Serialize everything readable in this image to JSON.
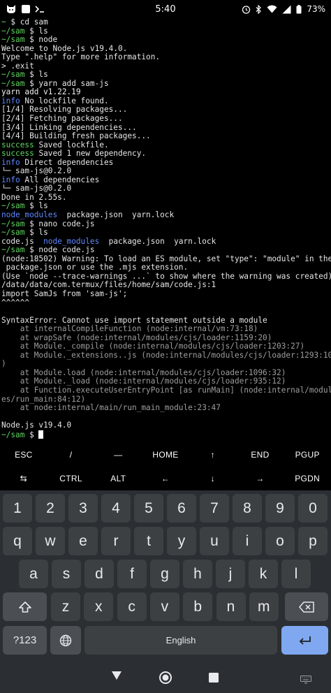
{
  "status_bar": {
    "time": "5:40",
    "battery": "73%",
    "left_icons": [
      "cat-app-icon",
      "image-notification-icon",
      "terminal-prompt-icon"
    ],
    "right_icons": [
      "alarm-icon",
      "bluetooth-icon",
      "wifi-icon",
      "signal-icon",
      "battery-icon"
    ]
  },
  "terminal": {
    "lines": [
      [
        {
          "t": "~ ",
          "c": "c-green"
        },
        {
          "t": "$ cd sam",
          "c": ""
        }
      ],
      [
        {
          "t": "~/sam ",
          "c": "c-green"
        },
        {
          "t": "$ ls",
          "c": ""
        }
      ],
      [
        {
          "t": "~/sam ",
          "c": "c-green"
        },
        {
          "t": "$ node",
          "c": ""
        }
      ],
      [
        {
          "t": "Welcome to Node.js v19.4.0.",
          "c": ""
        }
      ],
      [
        {
          "t": "Type \".help\" for more information.",
          "c": ""
        }
      ],
      [
        {
          "t": "> .exit",
          "c": ""
        }
      ],
      [
        {
          "t": "~/sam ",
          "c": "c-green"
        },
        {
          "t": "$ ls",
          "c": ""
        }
      ],
      [
        {
          "t": "~/sam ",
          "c": "c-green"
        },
        {
          "t": "$ yarn add sam-js",
          "c": ""
        }
      ],
      [
        {
          "t": "yarn add v1.22.19",
          "c": "c-white"
        }
      ],
      [
        {
          "t": "info",
          "c": "c-blue"
        },
        {
          "t": " No lockfile found.",
          "c": ""
        }
      ],
      [
        {
          "t": "[1/4] Resolving packages...",
          "c": ""
        }
      ],
      [
        {
          "t": "[2/4] Fetching packages...",
          "c": ""
        }
      ],
      [
        {
          "t": "[3/4] Linking dependencies...",
          "c": ""
        }
      ],
      [
        {
          "t": "[4/4] Building fresh packages...",
          "c": ""
        }
      ],
      [
        {
          "t": "success",
          "c": "c-green"
        },
        {
          "t": " Saved lockfile.",
          "c": ""
        }
      ],
      [
        {
          "t": "success",
          "c": "c-green"
        },
        {
          "t": " Saved 1 new dependency.",
          "c": ""
        }
      ],
      [
        {
          "t": "info",
          "c": "c-blue"
        },
        {
          "t": " Direct dependencies",
          "c": ""
        }
      ],
      [
        {
          "t": "└─ sam-js@0.2.0",
          "c": ""
        }
      ],
      [
        {
          "t": "info",
          "c": "c-blue"
        },
        {
          "t": " All dependencies",
          "c": ""
        }
      ],
      [
        {
          "t": "└─ sam-js@0.2.0",
          "c": ""
        }
      ],
      [
        {
          "t": "Done in 2.55s.",
          "c": ""
        }
      ],
      [
        {
          "t": "~/sam ",
          "c": "c-green"
        },
        {
          "t": "$ ls",
          "c": ""
        }
      ],
      [
        {
          "t": "node_modules",
          "c": "c-blue"
        },
        {
          "t": "  package.json  yarn.lock",
          "c": ""
        }
      ],
      [
        {
          "t": "~/sam ",
          "c": "c-green"
        },
        {
          "t": "$ nano code.js",
          "c": ""
        }
      ],
      [
        {
          "t": "~/sam ",
          "c": "c-green"
        },
        {
          "t": "$ ls",
          "c": ""
        }
      ],
      [
        {
          "t": "code.js  ",
          "c": ""
        },
        {
          "t": "node_modules",
          "c": "c-blue"
        },
        {
          "t": "  package.json  yarn.lock",
          "c": ""
        }
      ],
      [
        {
          "t": "~/sam ",
          "c": "c-green"
        },
        {
          "t": "$ node code.js",
          "c": ""
        }
      ],
      [
        {
          "t": "(node:18502) Warning: To load an ES module, set \"type\": \"module\" in the",
          "c": ""
        }
      ],
      [
        {
          "t": " package.json or use the .mjs extension.",
          "c": ""
        }
      ],
      [
        {
          "t": "(Use `node --trace-warnings ...` to show where the warning was created)",
          "c": ""
        }
      ],
      [
        {
          "t": "/data/data/com.termux/files/home/sam/code.js:1",
          "c": ""
        }
      ],
      [
        {
          "t": "import SamJs from 'sam-js';",
          "c": ""
        }
      ],
      [
        {
          "t": "^^^^^^",
          "c": ""
        }
      ],
      [
        {
          "t": "",
          "c": ""
        }
      ],
      [
        {
          "t": "SyntaxError: Cannot use import statement outside a module",
          "c": ""
        }
      ],
      [
        {
          "t": "    at internalCompileFunction (node:internal/vm:73:18)",
          "c": "c-gray"
        }
      ],
      [
        {
          "t": "    at wrapSafe (node:internal/modules/cjs/loader:1159:20)",
          "c": "c-gray"
        }
      ],
      [
        {
          "t": "    at Module._compile (node:internal/modules/cjs/loader:1203:27)",
          "c": "c-gray"
        }
      ],
      [
        {
          "t": "    at Module._extensions..js (node:internal/modules/cjs/loader:1293:10",
          "c": "c-gray"
        }
      ],
      [
        {
          "t": ")",
          "c": "c-gray"
        }
      ],
      [
        {
          "t": "    at Module.load (node:internal/modules/cjs/loader:1096:32)",
          "c": "c-gray"
        }
      ],
      [
        {
          "t": "    at Module._load (node:internal/modules/cjs/loader:935:12)",
          "c": "c-gray"
        }
      ],
      [
        {
          "t": "    at Function.executeUserEntryPoint [as runMain] (node:internal/modul",
          "c": "c-gray"
        }
      ],
      [
        {
          "t": "es/run_main:84:12)",
          "c": "c-gray"
        }
      ],
      [
        {
          "t": "    at node:internal/main/run_main_module:23:47",
          "c": "c-gray"
        }
      ],
      [
        {
          "t": "",
          "c": ""
        }
      ],
      [
        {
          "t": "Node.js v19.4.0",
          "c": ""
        }
      ],
      [
        {
          "t": "~/sam ",
          "c": "c-green"
        },
        {
          "t": "$ ",
          "c": ""
        }
      ]
    ]
  },
  "extra_keys": {
    "row1": [
      "ESC",
      "/",
      "—",
      "HOME",
      "↑",
      "END",
      "PGUP"
    ],
    "row2": [
      "⇆",
      "CTRL",
      "ALT",
      "←",
      "↓",
      "→",
      "PGDN"
    ]
  },
  "keyboard": {
    "row_numbers": [
      "1",
      "2",
      "3",
      "4",
      "5",
      "6",
      "7",
      "8",
      "9",
      "0"
    ],
    "row_q": [
      "q",
      "w",
      "e",
      "r",
      "t",
      "y",
      "u",
      "i",
      "o",
      "p"
    ],
    "row_a": [
      "a",
      "s",
      "d",
      "f",
      "g",
      "h",
      "j",
      "k",
      "l"
    ],
    "row_z": [
      "z",
      "x",
      "c",
      "v",
      "b",
      "n",
      "m"
    ],
    "symbols_label": "?123",
    "space_label": "English",
    "key_bg": "#3c4043",
    "mod_bg": "#4b4f53",
    "enter_bg": "#7fa8f0"
  },
  "nav_bar": {
    "buttons": [
      "back-icon",
      "home-icon",
      "recents-icon",
      "keyboard-switch-icon"
    ]
  }
}
